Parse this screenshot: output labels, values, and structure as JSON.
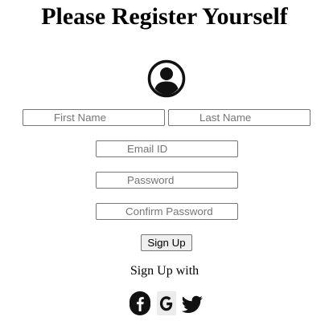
{
  "page": {
    "title": "Please Register Yourself"
  },
  "form": {
    "first_name": {
      "placeholder": "First Name",
      "value": ""
    },
    "last_name": {
      "placeholder": "Last Name",
      "value": ""
    },
    "email": {
      "placeholder": "Email ID",
      "value": ""
    },
    "password": {
      "placeholder": "Password",
      "value": ""
    },
    "confirm_password": {
      "placeholder": "Confirm Password",
      "value": ""
    },
    "submit_label": "Sign Up"
  },
  "social": {
    "heading": "Sign Up with",
    "icons": [
      "facebook-icon",
      "google-icon",
      "twitter-icon"
    ]
  },
  "icons": {
    "avatar": "user-circle-icon"
  }
}
